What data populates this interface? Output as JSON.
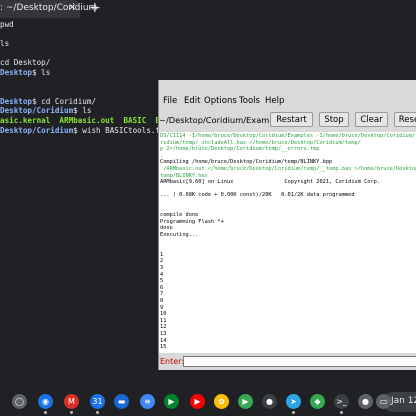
{
  "browser": {
    "tab_title": ": ~/Desktop/Coridium",
    "tab_close": "×",
    "new_tab": "+"
  },
  "terminal": {
    "lines": [
      {
        "parts": [
          {
            "t": "pwd",
            "c": ""
          }
        ]
      },
      {
        "parts": []
      },
      {
        "parts": [
          {
            "t": "ls",
            "c": ""
          }
        ]
      },
      {
        "parts": []
      },
      {
        "parts": [
          {
            "t": "cd Desktop/",
            "c": ""
          }
        ]
      },
      {
        "parts": [
          {
            "t": "Desktop",
            "c": "path"
          },
          {
            "t": "$ ls",
            "c": ""
          }
        ]
      },
      {
        "parts": []
      },
      {
        "parts": []
      },
      {
        "parts": [
          {
            "t": "Desktop",
            "c": "path"
          },
          {
            "t": "$ cd Coridium/",
            "c": ""
          }
        ]
      },
      {
        "parts": [
          {
            "t": "Desktop/Coridium",
            "c": "path"
          },
          {
            "t": "$ ls",
            "c": ""
          }
        ]
      },
      {
        "parts": [
          {
            "t": "asic.kernal  ARMbasic.out  BASIC  BASI",
            "c": "green"
          }
        ]
      },
      {
        "parts": [
          {
            "t": "Desktop/Coridium",
            "c": "path"
          },
          {
            "t": "$ wish BASICtools.tcl",
            "c": ""
          }
        ]
      }
    ]
  },
  "app": {
    "menu": [
      "File",
      "Edit",
      "Options",
      "Tools",
      "Help"
    ],
    "path": "~/Desktop/Coridium/Examples",
    "buttons": {
      "restart": "Restart",
      "stop": "Stop",
      "clear": "Clear",
      "reset": "Rese"
    },
    "output_lines": [
      {
        "t": "DS/C1114 -I/home/bruce/Desktop/Coridium/Examples -I/home/bruce/Desktop/Coridium/",
        "g": true
      },
      {
        "t": "ridium/temp/_includeAll.bas >/home/bruce/Desktop/Coridium/temp/",
        "g": true
      },
      {
        "t": "p 2>/home/bruce/Desktop/Coridium/temp/__errors.tmp",
        "g": true
      },
      {
        "t": ".",
        "g": true
      },
      {
        "t": "Compiling /home/bruce/Desktop/Coridium/temp/BLINKY.bpp",
        "g": false
      },
      {
        "t": " /ARMbasic.out </home/bruce/Desktop/Coridium/temp/__temp.bas >/home/bruce/Desktop/",
        "g": true
      },
      {
        "t": "temp/BLINKY.hex",
        "g": true
      },
      {
        "t": "ARMbasic[9.60] on Linux                Copyright 2021, Coridium Corp.",
        "g": false
      },
      {
        "t": "",
        "g": false
      },
      {
        "t": "... ( 0.08K code + 0.00K const)/20K   0.01/2K data programmed",
        "g": false
      },
      {
        "t": "",
        "g": false
      },
      {
        "t": "",
        "g": false
      },
      {
        "t": "compile done",
        "g": false
      },
      {
        "t": "Programming Flash *+",
        "g": false
      },
      {
        "t": "done",
        "g": false
      },
      {
        "t": "Executing...",
        "g": false
      },
      {
        "t": "",
        "g": false
      },
      {
        "t": "",
        "g": false
      },
      {
        "t": "1",
        "g": false
      },
      {
        "t": "2",
        "g": false
      },
      {
        "t": "3",
        "g": false
      },
      {
        "t": "4",
        "g": false
      },
      {
        "t": "5",
        "g": false
      },
      {
        "t": "6",
        "g": false
      },
      {
        "t": "7",
        "g": false
      },
      {
        "t": "8",
        "g": false
      },
      {
        "t": "9",
        "g": false
      },
      {
        "t": "10",
        "g": false
      },
      {
        "t": "11",
        "g": false
      },
      {
        "t": "12",
        "g": false
      },
      {
        "t": "13",
        "g": false
      },
      {
        "t": "14",
        "g": false
      },
      {
        "t": "15",
        "g": false
      }
    ],
    "enter_label": "Enter:"
  },
  "shelf": {
    "apps": [
      {
        "name": "launcher-icon",
        "glyph": "◯",
        "color": "#5f6368"
      },
      {
        "name": "chrome-icon",
        "glyph": "◉",
        "color": "#1a73e8"
      },
      {
        "name": "gmail-icon",
        "glyph": "M",
        "color": "#d93025"
      },
      {
        "name": "calendar-icon",
        "glyph": "31",
        "color": "#1a73e8"
      },
      {
        "name": "files-icon",
        "glyph": "▬",
        "color": "#1967d2"
      },
      {
        "name": "docs-icon",
        "glyph": "≡",
        "color": "#4285f4"
      },
      {
        "name": "meet-icon",
        "glyph": "▶",
        "color": "#00832d"
      },
      {
        "name": "youtube-icon",
        "glyph": "▶",
        "color": "#ff0000"
      },
      {
        "name": "photos-icon",
        "glyph": "✿",
        "color": "#fbbc04"
      },
      {
        "name": "play-store-icon",
        "glyph": "▶",
        "color": "#34a853"
      },
      {
        "name": "camera-icon",
        "glyph": "●",
        "color": "#3c4043"
      },
      {
        "name": "telegram-icon",
        "glyph": "➤",
        "color": "#2aa4e5"
      },
      {
        "name": "maps-icon",
        "glyph": "◆",
        "color": "#34a853"
      },
      {
        "name": "terminal-icon",
        "glyph": ">_",
        "color": "#3c4043"
      },
      {
        "name": "linux-penguin-icon",
        "glyph": "●",
        "color": "#5f6368"
      },
      {
        "name": "notes-icon",
        "glyph": "▭",
        "color": "#5f6368"
      }
    ],
    "date": "Jan 12"
  },
  "colors": {
    "terminal_bg": "#202124",
    "prompt_path": "#8ab4f8",
    "highlight_green": "#8ae234",
    "output_green": "#2ea043",
    "enter_label": "#c00000"
  }
}
